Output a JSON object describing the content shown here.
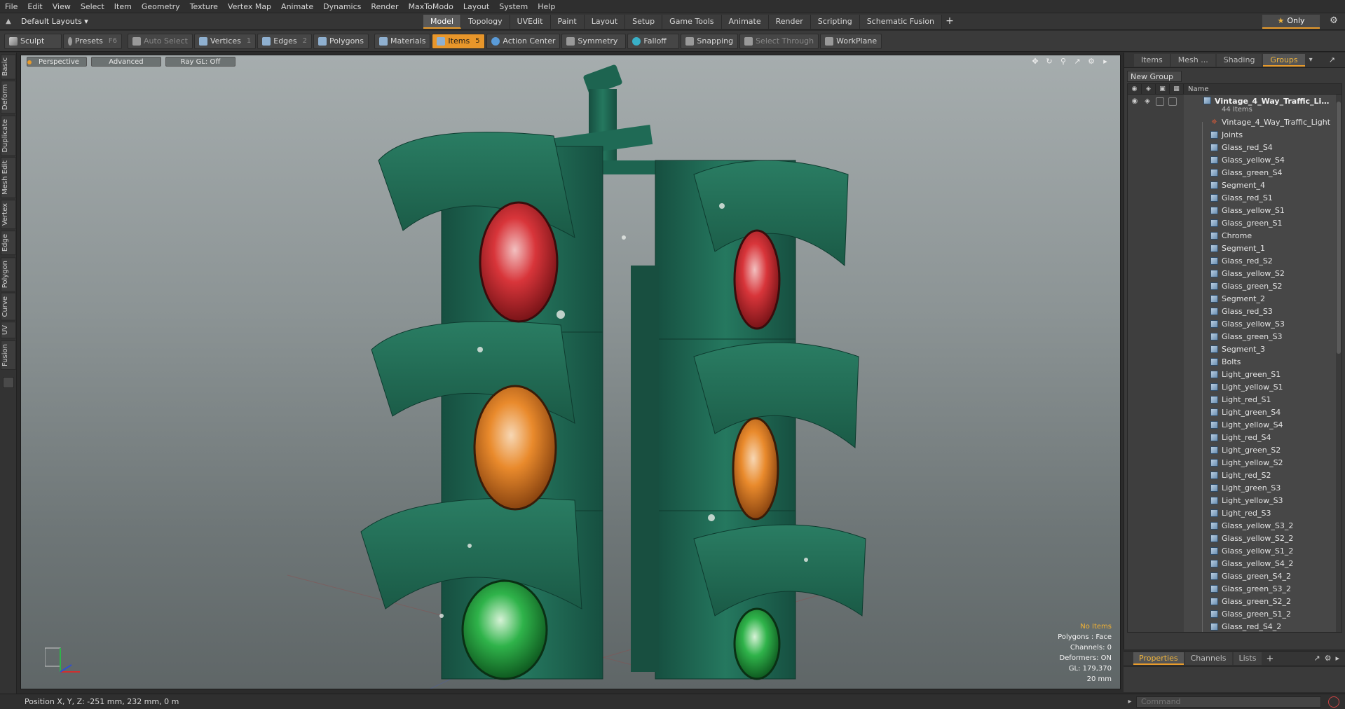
{
  "menu": [
    "File",
    "Edit",
    "View",
    "Select",
    "Item",
    "Geometry",
    "Texture",
    "Vertex Map",
    "Animate",
    "Dynamics",
    "Render",
    "MaxToModo",
    "Layout",
    "System",
    "Help"
  ],
  "layout": {
    "dropdown": "Default Layouts ▾"
  },
  "tabs": [
    {
      "label": "Model",
      "active": true
    },
    {
      "label": "Topology"
    },
    {
      "label": "UVEdit"
    },
    {
      "label": "Paint"
    },
    {
      "label": "Layout"
    },
    {
      "label": "Setup"
    },
    {
      "label": "Game Tools"
    },
    {
      "label": "Animate"
    },
    {
      "label": "Render"
    },
    {
      "label": "Scripting"
    },
    {
      "label": "Schematic Fusion"
    }
  ],
  "tab_add": "+",
  "only_label": "Only",
  "toolbar": {
    "sculpt": "Sculpt",
    "presets": "Presets",
    "presets_key": "F6",
    "auto_select": "Auto Select",
    "vertices": "Vertices",
    "vertices_key": "1",
    "edges": "Edges",
    "edges_key": "2",
    "polygons": "Polygons",
    "materials": "Materials",
    "items": "Items",
    "items_key": "5",
    "action_center": "Action Center",
    "symmetry": "Symmetry",
    "falloff": "Falloff",
    "snapping": "Snapping",
    "select_through": "Select Through",
    "workplane": "WorkPlane"
  },
  "left_tabs": [
    "Basic",
    "Deform",
    "Duplicate",
    "Mesh Edit",
    "Vertex",
    "Edge",
    "Polygon",
    "Curve",
    "UV",
    "Fusion"
  ],
  "viewport": {
    "view": "Perspective",
    "shading": "Advanced",
    "raygl": "Ray GL: Off",
    "info": {
      "selection": "No Items",
      "polygons": "Polygons : Face",
      "channels": "Channels: 0",
      "deformers": "Deformers: ON",
      "gl": "GL: 179,370",
      "scale": "20 mm"
    }
  },
  "right_panel": {
    "tabs": [
      {
        "label": "Items"
      },
      {
        "label": "Mesh ..."
      },
      {
        "label": "Shading"
      },
      {
        "label": "Groups",
        "active": true
      }
    ],
    "new_group": "New Group",
    "name_header": "Name",
    "group": {
      "name": "Vintage_4_Way_Traffic_Lig...",
      "count": "44 Items"
    },
    "items": [
      "Vintage_4_Way_Traffic_Light",
      "Joints",
      "Glass_red_S4",
      "Glass_yellow_S4",
      "Glass_green_S4",
      "Segment_4",
      "Glass_red_S1",
      "Glass_yellow_S1",
      "Glass_green_S1",
      "Chrome",
      "Segment_1",
      "Glass_red_S2",
      "Glass_yellow_S2",
      "Glass_green_S2",
      "Segment_2",
      "Glass_red_S3",
      "Glass_yellow_S3",
      "Glass_green_S3",
      "Segment_3",
      "Bolts",
      "Light_green_S1",
      "Light_yellow_S1",
      "Light_red_S1",
      "Light_green_S4",
      "Light_yellow_S4",
      "Light_red_S4",
      "Light_green_S2",
      "Light_yellow_S2",
      "Light_red_S2",
      "Light_green_S3",
      "Light_yellow_S3",
      "Light_red_S3",
      "Glass_yellow_S3_2",
      "Glass_yellow_S2_2",
      "Glass_yellow_S1_2",
      "Glass_yellow_S4_2",
      "Glass_green_S4_2",
      "Glass_green_S3_2",
      "Glass_green_S2_2",
      "Glass_green_S1_2",
      "Glass_red_S4_2"
    ],
    "bottom_tabs": [
      {
        "label": "Properties",
        "active": true
      },
      {
        "label": "Channels"
      },
      {
        "label": "Lists"
      }
    ],
    "bottom_add": "+"
  },
  "status": {
    "position": "Position X, Y, Z:  -251 mm, 232 mm, 0 m"
  },
  "command": {
    "placeholder": "Command"
  },
  "colors": {
    "accent": "#e8962a",
    "housing": "#1f6b55",
    "red_lens": "#d8353a",
    "amber_lens": "#e98a2c",
    "green_lens": "#2fb34a"
  }
}
